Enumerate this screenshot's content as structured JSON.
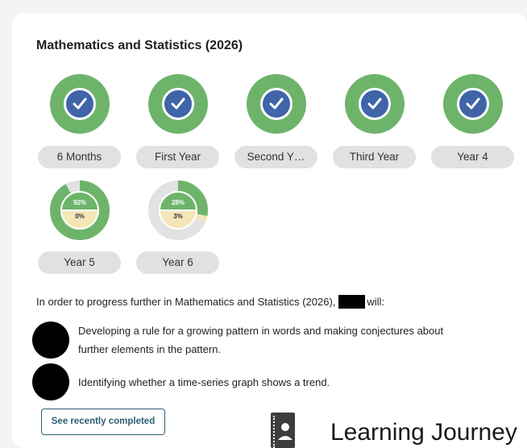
{
  "subject": {
    "title": "Mathematics and Statistics (2026)"
  },
  "colors": {
    "complete_ring": "#6db46a",
    "check_fill": "#3f64a8",
    "pill_bg": "#e1e1e1",
    "button_text": "#2d5f73"
  },
  "milestones": [
    {
      "label": "6 Months",
      "status": "complete",
      "icon": "check-icon"
    },
    {
      "label": "First Year",
      "status": "complete",
      "icon": "check-icon"
    },
    {
      "label": "Second Y…",
      "status": "complete",
      "icon": "check-icon"
    },
    {
      "label": "Third Year",
      "status": "complete",
      "icon": "check-icon"
    },
    {
      "label": "Year 4",
      "status": "complete",
      "icon": "check-icon"
    },
    {
      "label": "Year 5",
      "status": "in-progress",
      "progress_text": "92%",
      "secondary_text": "0%",
      "progress_value": 0.92
    },
    {
      "label": "Year 6",
      "status": "in-progress",
      "progress_text": "28%",
      "secondary_text": "3%",
      "progress_value": 0.28
    }
  ],
  "progress": {
    "lead_in": "In order to progress further in Mathematics and Statistics (2026),",
    "tail": "will:"
  },
  "tasks": [
    {
      "line1": "Developing a rule for a growing pattern in words and making conjectures about",
      "line2": "further elements in the pattern."
    },
    {
      "line1": "Identifying whether a time-series graph shows a trend.",
      "line2": ""
    }
  ],
  "buttons": {
    "see_recently_completed": "See recently completed"
  },
  "learning_journey": {
    "label": "Learning Journey",
    "icon": "journal-icon"
  }
}
